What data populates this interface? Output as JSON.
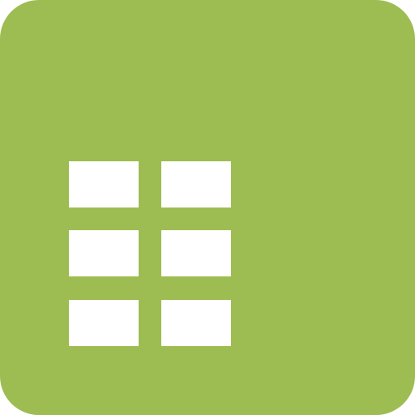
{
  "icon": {
    "name": "grid-table-icon",
    "background_color": "#9dbd52",
    "glyph_color": "#ffffff",
    "grid": {
      "rows": 3,
      "columns": 2
    }
  }
}
